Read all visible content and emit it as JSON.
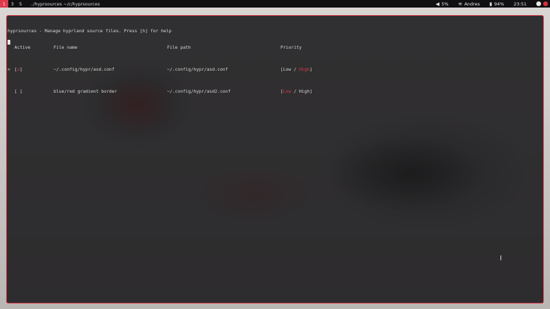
{
  "topbar": {
    "workspaces": [
      "1",
      "3",
      "5"
    ],
    "active_workspace": "1",
    "window_title": "../hyprsources ~/c/hyprsources",
    "volume": "5%",
    "network": "Andres",
    "battery": "94%",
    "clock": "23:51"
  },
  "terminal": {
    "header": "hyprsources - Manage hyprland source files. Press [h] for help",
    "columns": {
      "active": "Active",
      "file_name": "File name",
      "file_path": "File path",
      "priority": "Priority"
    },
    "rows": [
      {
        "selector": ">",
        "active_open": "[",
        "active_mark": "x",
        "active_close": "]",
        "file_name": "~/.config/hypr/asd.conf",
        "file_path": "~/.config/hypr/asd.conf",
        "priority_open": "[",
        "priority_low": "Low",
        "priority_sep": " / ",
        "priority_high": "High",
        "priority_close": "]",
        "selected_priority": "High"
      },
      {
        "selector": "",
        "active_open": "[",
        "active_mark": " ",
        "active_close": "]",
        "file_name": "blue/red gradient border",
        "file_path": "~/.config/hypr/asd2.conf",
        "priority_open": "[",
        "priority_low": "Low",
        "priority_sep": " / ",
        "priority_high": "High",
        "priority_close": "]",
        "selected_priority": "Low"
      }
    ]
  },
  "colors": {
    "accent": "#e0394a",
    "terminal_bg": "#1e1d1f",
    "text": "#d9d9d9"
  },
  "icons": [
    "volume-icon",
    "wifi-icon",
    "battery-icon",
    "tray-icon",
    "tray-icon-red",
    "text-cursor-icon"
  ]
}
